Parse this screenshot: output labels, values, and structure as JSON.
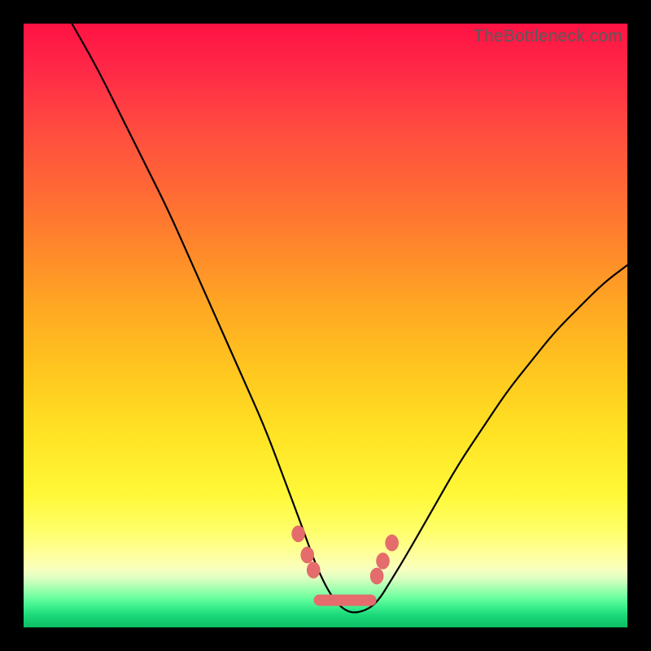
{
  "watermark": "TheBottleneck.com",
  "colors": {
    "frame": "#000000",
    "curve": "#000000",
    "marker": "#e56c6c",
    "gradient_top": "#ff1244",
    "gradient_mid": "#ffe324",
    "gradient_bottom": "#0bbd63"
  },
  "chart_data": {
    "type": "line",
    "title": "",
    "xlabel": "",
    "ylabel": "",
    "xlim": [
      0,
      100
    ],
    "ylim": [
      0,
      100
    ],
    "series": [
      {
        "name": "bottleneck-curve",
        "x": [
          8,
          12,
          16,
          20,
          24,
          28,
          32,
          36,
          40,
          43,
          46,
          48.5,
          51,
          53.5,
          56,
          58.5,
          61,
          64,
          68,
          72,
          76,
          80,
          84,
          88,
          92,
          96,
          100
        ],
        "y": [
          100,
          93,
          85,
          77,
          69,
          60,
          51,
          42,
          33,
          25,
          17,
          10,
          5,
          2.5,
          2.5,
          4,
          8,
          13,
          20,
          27,
          33,
          39,
          44,
          49,
          53,
          57,
          60
        ]
      }
    ],
    "markers": {
      "name": "highlight-dots",
      "x": [
        45.5,
        47.0,
        48.0,
        58.5,
        59.5,
        61.0
      ],
      "y": [
        15.5,
        12.0,
        9.5,
        8.5,
        11.0,
        14.0
      ]
    },
    "plateau": {
      "name": "plateau-segment",
      "x": [
        49.0,
        57.5
      ],
      "y": [
        4.5,
        4.5
      ]
    },
    "annotations": []
  }
}
